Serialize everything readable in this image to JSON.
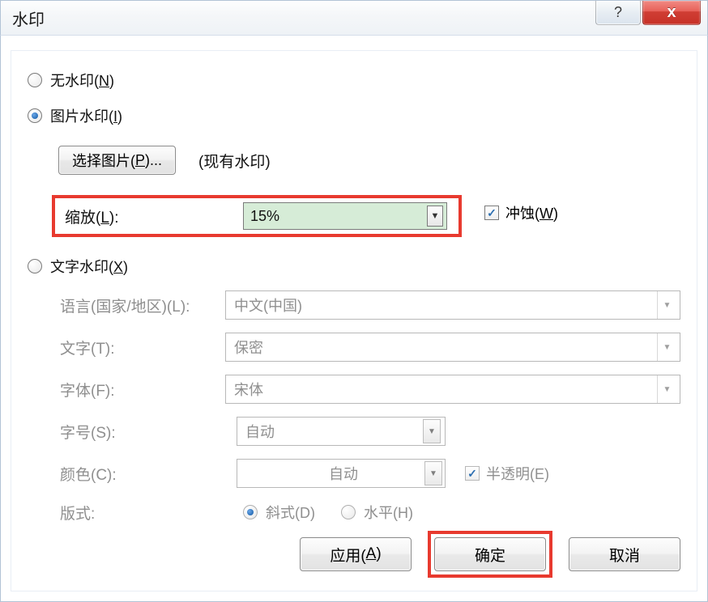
{
  "titlebar": {
    "title": "水印",
    "help": "?",
    "close": "x"
  },
  "radios": {
    "none": {
      "label_pre": "无水印(",
      "accel": "N",
      "label_post": ")"
    },
    "picture": {
      "label_pre": "图片水印(",
      "accel": "I",
      "label_post": ")"
    },
    "text": {
      "label_pre": "文字水印(",
      "accel": "X",
      "label_post": ")"
    }
  },
  "picture": {
    "select_btn_pre": "选择图片(",
    "select_btn_accel": "P",
    "select_btn_post": ")...",
    "existing": "(现有水印)",
    "scale_label_pre": "缩放(",
    "scale_accel": "L",
    "scale_label_post": "):",
    "scale_value": "15%",
    "washout_pre": "冲蚀(",
    "washout_accel": "W",
    "washout_post": ")"
  },
  "text": {
    "language_label": "语言(国家/地区)(L):",
    "language_value": "中文(中国)",
    "content_label": "文字(T):",
    "content_value": "保密",
    "font_label": "字体(F):",
    "font_value": "宋体",
    "size_label": "字号(S):",
    "size_value": "自动",
    "color_label": "颜色(C):",
    "color_value": "自动",
    "semi_label": "半透明(E)",
    "layout_label": "版式:",
    "layout_diag": "斜式(D)",
    "layout_horiz": "水平(H)"
  },
  "buttons": {
    "apply_pre": "应用(",
    "apply_accel": "A",
    "apply_post": ")",
    "ok": "确定",
    "cancel": "取消"
  }
}
